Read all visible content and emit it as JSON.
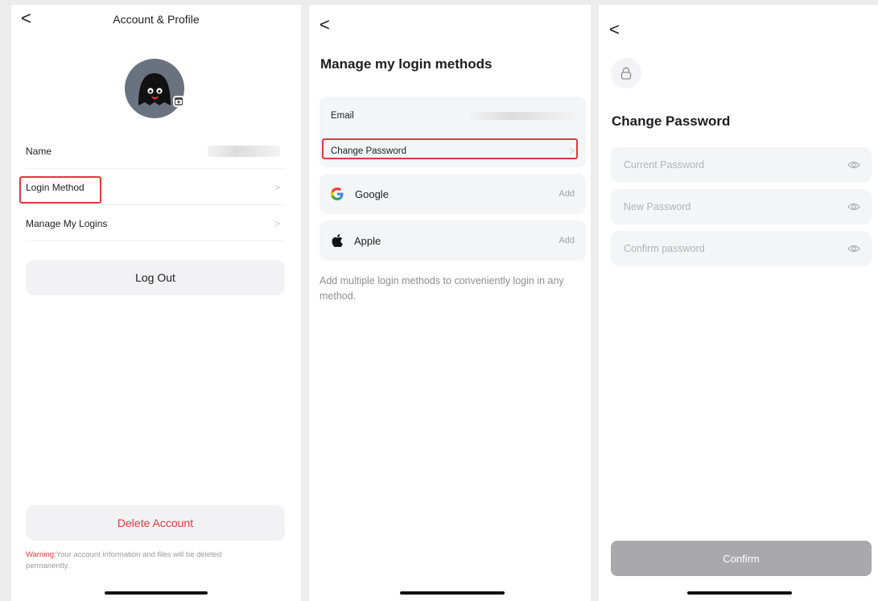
{
  "account_profile": {
    "title": "Account & Profile",
    "back_glyph": "<",
    "rows": [
      {
        "label": "Name"
      },
      {
        "label": "Login Method",
        "chevron": ">"
      },
      {
        "label": "Manage My Logins",
        "chevron": ">"
      }
    ],
    "logout_label": "Log Out",
    "delete_label": "Delete Account",
    "warning_prefix": "Warning:",
    "warning_text": "Your account information and files will be deleted permanently."
  },
  "login_methods": {
    "back_glyph": "<",
    "title": "Manage my login methods",
    "email_label": "Email",
    "change_password_label": "Change Password",
    "change_password_chevron": ">",
    "providers": [
      {
        "name": "Google",
        "action": "Add"
      },
      {
        "name": "Apple",
        "action": "Add"
      }
    ],
    "note": "Add multiple login methods to conveniently login in any method."
  },
  "change_password": {
    "back_glyph": "<",
    "title": "Change Password",
    "fields": [
      {
        "placeholder": "Current Password"
      },
      {
        "placeholder": "New Password"
      },
      {
        "placeholder": "Confirm password"
      }
    ],
    "confirm_label": "Confirm"
  },
  "colors": {
    "highlight": "#e0383e",
    "danger_text": "#e0383e",
    "confirm_disabled": "#a9a9ab",
    "card_bg": "#f4f5f7",
    "avatar_bg": "#6a7280"
  },
  "icons": [
    "back-chevron-icon",
    "camera-icon",
    "chevron-right-icon",
    "google-icon",
    "apple-icon",
    "lock-icon",
    "eye-icon"
  ]
}
